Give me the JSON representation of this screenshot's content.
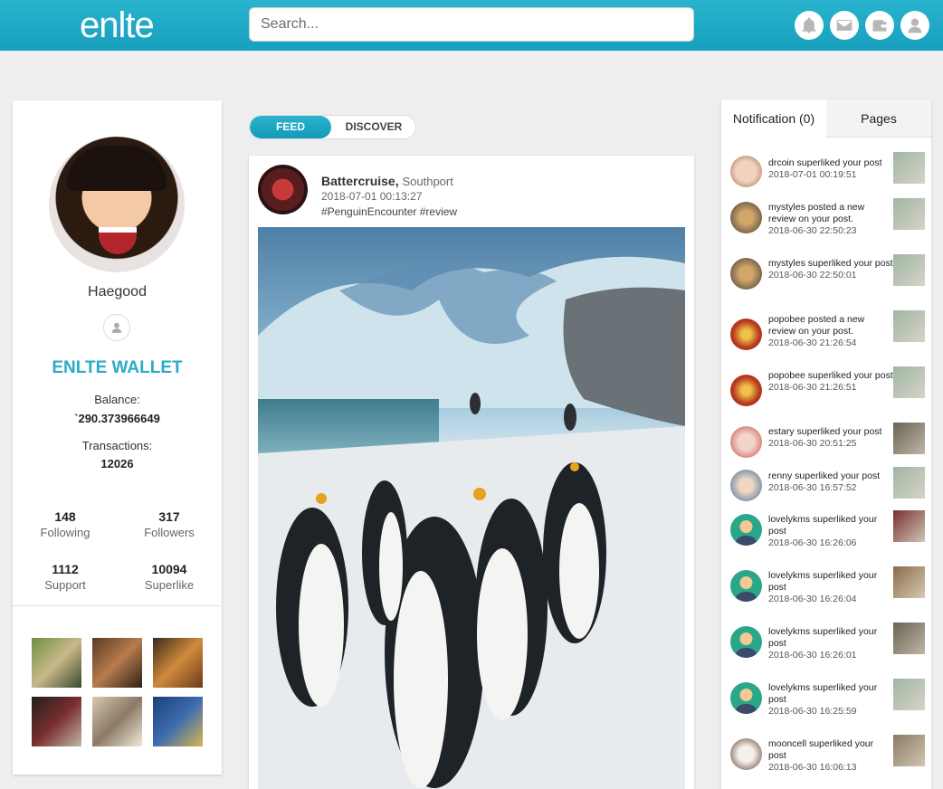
{
  "header": {
    "logo": "enlte",
    "search_placeholder": "Search...",
    "icons": [
      "bell-icon",
      "mail-icon",
      "wallet-icon",
      "user-icon"
    ]
  },
  "profile": {
    "username": "Haegood",
    "wallet_title": "ENLTE WALLET",
    "balance_label": "Balance:",
    "balance_value": "`290.373966649",
    "transactions_label": "Transactions:",
    "transactions_value": "12026",
    "stats": {
      "following": {
        "num": "148",
        "label": "Following"
      },
      "followers": {
        "num": "317",
        "label": "Followers"
      },
      "support": {
        "num": "1112",
        "label": "Support"
      },
      "superlike": {
        "num": "10094",
        "label": "Superlike"
      }
    }
  },
  "feed": {
    "tabs": {
      "feed": "FEED",
      "discover": "DISCOVER"
    },
    "post": {
      "author": "Battercruise,",
      "location": "Southport",
      "time": "2018-07-01 00:13:27",
      "tags": "#PenguinEncounter #review"
    }
  },
  "notifications": {
    "tab_label": "Notification (0)",
    "pages_label": "Pages",
    "items": [
      {
        "text": "drcoin superliked your post",
        "time": "2018-07-01 00:19:51"
      },
      {
        "text": "mystyles posted a new review on your post.",
        "time": "2018-06-30 22:50:23"
      },
      {
        "text": "mystyles superliked your post",
        "time": "2018-06-30 22:50:01"
      },
      {
        "text": "popobee posted a new review on your post.",
        "time": "2018-06-30 21:26:54"
      },
      {
        "text": "popobee superliked your post",
        "time": "2018-06-30 21:26:51"
      },
      {
        "text": "estary superliked your post",
        "time": "2018-06-30 20:51:25"
      },
      {
        "text": "renny superliked your post",
        "time": "2018-06-30 16:57:52"
      },
      {
        "text": "lovelykms superliked your post",
        "time": "2018-06-30 16:26:06"
      },
      {
        "text": "lovelykms superliked your post",
        "time": "2018-06-30 16:26:04"
      },
      {
        "text": "lovelykms superliked your post",
        "time": "2018-06-30 16:26:01"
      },
      {
        "text": "lovelykms superliked your post",
        "time": "2018-06-30 16:25:59"
      },
      {
        "text": "mooncell superliked your post",
        "time": "2018-06-30 16:06:13"
      }
    ]
  }
}
